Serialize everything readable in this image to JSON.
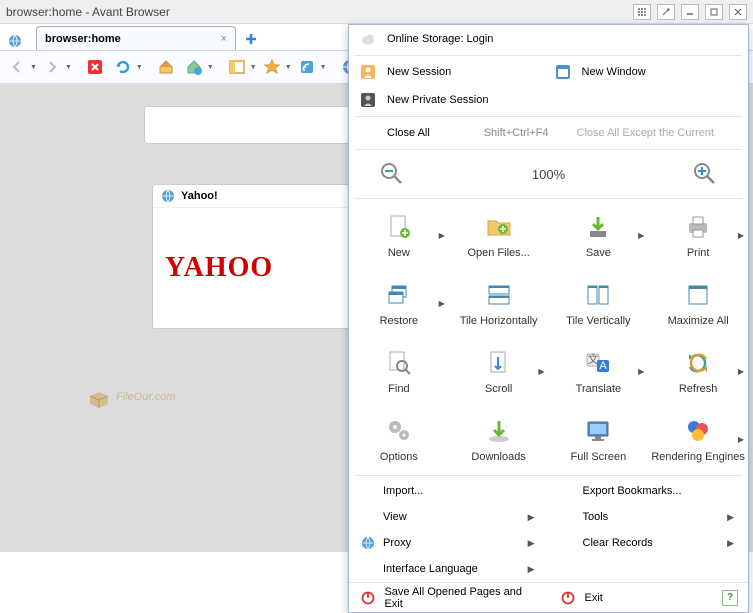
{
  "window": {
    "title": "browser:home - Avant Browser"
  },
  "tab": {
    "label": "browser:home"
  },
  "menu": {
    "online_storage": "Online Storage: Login",
    "new_session": "New Session",
    "new_window": "New Window",
    "new_private": "New Private Session",
    "close_all": "Close All",
    "close_all_key": "Shift+Ctrl+F4",
    "close_all_except": "Close All Except the Current",
    "zoom": "100%",
    "grid": {
      "new": "New",
      "open_files": "Open Files...",
      "save": "Save",
      "print": "Print",
      "restore": "Restore",
      "tile_h": "Tile Horizontally",
      "tile_v": "Tile Vertically",
      "maximize": "Maximize All",
      "find": "Find",
      "scroll": "Scroll",
      "translate": "Translate",
      "refresh": "Refresh",
      "options": "Options",
      "downloads": "Downloads",
      "fullscreen": "Full Screen",
      "rendering": "Rendering Engines"
    },
    "import": "Import...",
    "export_bookmarks": "Export Bookmarks...",
    "view": "View",
    "tools": "Tools",
    "proxy": "Proxy",
    "clear_records": "Clear Records",
    "interface_lang": "Interface Language",
    "save_exit": "Save All Opened Pages and Exit",
    "exit": "Exit"
  },
  "page": {
    "card_title": "Yahoo!",
    "logo_text": "YAHOO",
    "watermark": "FileOur.com"
  }
}
